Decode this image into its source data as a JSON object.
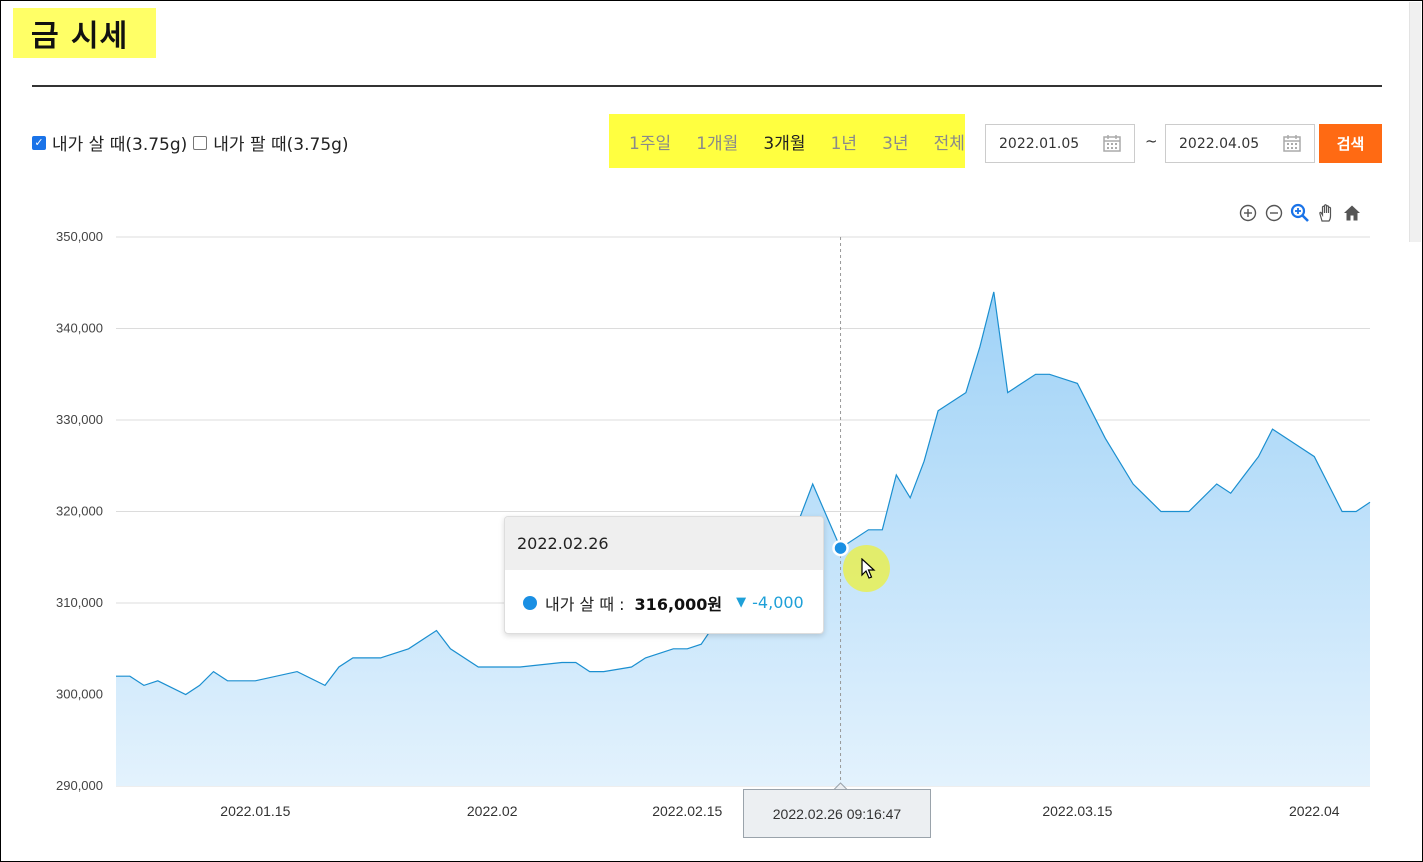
{
  "page": {
    "title": "금 시세"
  },
  "filters": {
    "buy": {
      "label": "내가 살 때(3.75g)",
      "checked": true
    },
    "sell": {
      "label": "내가 팔 때(3.75g)",
      "checked": false
    }
  },
  "periods": [
    {
      "label": "1주일",
      "active": false
    },
    {
      "label": "1개월",
      "active": false
    },
    {
      "label": "3개월",
      "active": true
    },
    {
      "label": "1년",
      "active": false
    },
    {
      "label": "3년",
      "active": false
    },
    {
      "label": "전체",
      "active": false
    }
  ],
  "date_range": {
    "start": "2022.01.05",
    "separator": "~",
    "end": "2022.04.05"
  },
  "search_button": "검색",
  "toolbar": [
    "zoom-in-icon",
    "zoom-out-icon",
    "zoom-select-icon",
    "pan-hand-icon",
    "reset-home-icon"
  ],
  "colors": {
    "accent": "#ff6a13",
    "series_line": "#1b8fd0",
    "area_top": "#9fd2f7",
    "area_bottom": "#e3f2fd",
    "highlight": "#ffff40"
  },
  "tooltip": {
    "date": "2022.02.26",
    "series": "내가 살 때",
    "colon": ":",
    "value": "316,000원",
    "diff": "-4,000"
  },
  "crosshair_label": "2022.02.26 09:16:47",
  "chart_data": {
    "type": "area",
    "y_ticks": [
      "290,000",
      "300,000",
      "310,000",
      "320,000",
      "330,000",
      "340,000",
      "350,000"
    ],
    "ylim": [
      290000,
      350000
    ],
    "x_ticks": [
      "2022.01.15",
      "2022.02",
      "2022.02.15",
      "2022.03.15",
      "2022.04"
    ],
    "x_range": [
      "2022-01-05",
      "2022-04-05"
    ],
    "grid": true,
    "series": [
      {
        "name": "내가 살 때",
        "points": [
          [
            "2022-01-05",
            302000
          ],
          [
            "2022-01-06",
            302000
          ],
          [
            "2022-01-07",
            301000
          ],
          [
            "2022-01-08",
            301500
          ],
          [
            "2022-01-10",
            300000
          ],
          [
            "2022-01-11",
            301000
          ],
          [
            "2022-01-12",
            302500
          ],
          [
            "2022-01-13",
            301500
          ],
          [
            "2022-01-15",
            301500
          ],
          [
            "2022-01-18",
            302500
          ],
          [
            "2022-01-20",
            301000
          ],
          [
            "2022-01-21",
            303000
          ],
          [
            "2022-01-22",
            304000
          ],
          [
            "2022-01-24",
            304000
          ],
          [
            "2022-01-26",
            305000
          ],
          [
            "2022-01-28",
            307000
          ],
          [
            "2022-01-29",
            305000
          ],
          [
            "2022-01-31",
            303000
          ],
          [
            "2022-02-03",
            303000
          ],
          [
            "2022-02-06",
            303500
          ],
          [
            "2022-02-07",
            303500
          ],
          [
            "2022-02-08",
            302500
          ],
          [
            "2022-02-09",
            302500
          ],
          [
            "2022-02-11",
            303000
          ],
          [
            "2022-02-12",
            304000
          ],
          [
            "2022-02-14",
            305000
          ],
          [
            "2022-02-15",
            305000
          ],
          [
            "2022-02-16",
            305500
          ],
          [
            "2022-02-18",
            310000
          ],
          [
            "2022-02-20",
            315000
          ],
          [
            "2022-02-22",
            316000
          ],
          [
            "2022-02-23",
            319000
          ],
          [
            "2022-02-24",
            323000
          ],
          [
            "2022-02-26",
            316000
          ],
          [
            "2022-02-28",
            318000
          ],
          [
            "2022-03-01",
            318000
          ],
          [
            "2022-03-02",
            324000
          ],
          [
            "2022-03-03",
            321500
          ],
          [
            "2022-03-04",
            325500
          ],
          [
            "2022-03-05",
            331000
          ],
          [
            "2022-03-07",
            333000
          ],
          [
            "2022-03-08",
            338000
          ],
          [
            "2022-03-09",
            344000
          ],
          [
            "2022-03-10",
            333000
          ],
          [
            "2022-03-11",
            334000
          ],
          [
            "2022-03-12",
            335000
          ],
          [
            "2022-03-13",
            335000
          ],
          [
            "2022-03-15",
            334000
          ],
          [
            "2022-03-17",
            328000
          ],
          [
            "2022-03-19",
            323000
          ],
          [
            "2022-03-21",
            320000
          ],
          [
            "2022-03-23",
            320000
          ],
          [
            "2022-03-25",
            323000
          ],
          [
            "2022-03-26",
            322000
          ],
          [
            "2022-03-27",
            324000
          ],
          [
            "2022-03-28",
            326000
          ],
          [
            "2022-03-29",
            329000
          ],
          [
            "2022-03-31",
            327000
          ],
          [
            "2022-04-01",
            326000
          ],
          [
            "2022-04-02",
            323000
          ],
          [
            "2022-04-03",
            320000
          ],
          [
            "2022-04-04",
            320000
          ],
          [
            "2022-04-05",
            321000
          ]
        ]
      }
    ],
    "highlight_point": [
      "2022-02-26",
      316000
    ]
  }
}
